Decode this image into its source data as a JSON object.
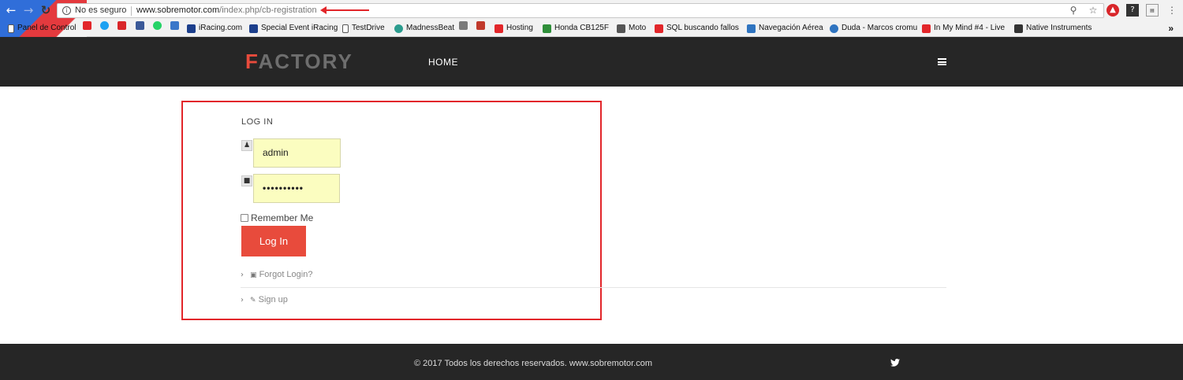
{
  "browser": {
    "security_label": "No es seguro",
    "url_host": "www.sobremotor.com",
    "url_path": "/index.php/cb-registration",
    "bookmarks": [
      {
        "label": "Panel de Control",
        "color": "#1b5fd6"
      },
      {
        "label": "",
        "color": "#e2262a"
      },
      {
        "label": "",
        "color": "#1da1f2"
      },
      {
        "label": "",
        "color": "#d9262a"
      },
      {
        "label": "",
        "color": "#3b5998"
      },
      {
        "label": "",
        "color": "#25d366"
      },
      {
        "label": "",
        "color": "#3a77c9"
      },
      {
        "label": "iRacing.com",
        "color": "#1c3f8c"
      },
      {
        "label": "Special Event iRacing",
        "color": "#1c3f8c"
      },
      {
        "label": "TestDrive",
        "color": "#888888"
      },
      {
        "label": "MadnessBeat",
        "color": "#2b9c8e"
      },
      {
        "label": "",
        "color": "#7a7a7a"
      },
      {
        "label": "",
        "color": "#c0392b"
      },
      {
        "label": "Hosting",
        "color": "#e2262a"
      },
      {
        "label": "Honda CB125F",
        "color": "#2f8f3a"
      },
      {
        "label": "Moto",
        "color": "#555555"
      },
      {
        "label": "SQL buscando fallos",
        "color": "#e2262a"
      },
      {
        "label": "Navegación Aérea",
        "color": "#2f74c0"
      },
      {
        "label": "Duda - Marcos cromu",
        "color": "#2f74c0"
      },
      {
        "label": "In My Mind #4 - Live",
        "color": "#e2262a"
      },
      {
        "label": "Native Instruments",
        "color": "#333333"
      }
    ],
    "more_label": "»"
  },
  "header": {
    "logo_first": "F",
    "logo_rest": "ACTORY",
    "nav_home": "HOME"
  },
  "login": {
    "title": "LOG IN",
    "username_value": "admin",
    "password_value": "••••••••••",
    "remember_label": "Remember Me",
    "submit_label": "Log In",
    "forgot_label": "Forgot Login?",
    "signup_label": "Sign up"
  },
  "footer": {
    "copyright": "© 2017 Todos los derechos reservados. www.sobremotor.com"
  },
  "colors": {
    "accent": "#e84b3c",
    "header_bg": "#262626",
    "autofill_bg": "#fbfdc0",
    "annotation_red": "#e2262a"
  }
}
